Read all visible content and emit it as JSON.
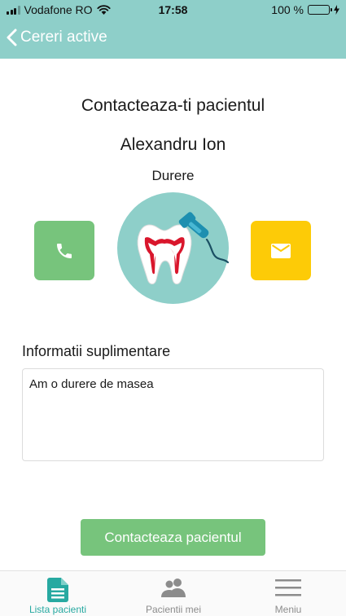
{
  "status_bar": {
    "carrier": "Vodafone RO",
    "time": "17:58",
    "battery": "100 %",
    "battery_level": 1.0
  },
  "nav": {
    "back_label": "Cereri active"
  },
  "main": {
    "title": "Contacteaza-ti pacientul",
    "patient_name": "Alexandru Ion",
    "category": "Durere",
    "info_label": "Informatii suplimentare",
    "info_text": "Am o durere de masea",
    "contact_button": "Contacteaza pacientul"
  },
  "tabs": [
    {
      "label": "Lista pacienti",
      "icon": "document-icon",
      "active": true
    },
    {
      "label": "Pacientii mei",
      "icon": "users-icon",
      "active": false
    },
    {
      "label": "Meniu",
      "icon": "hamburger-menu-icon",
      "active": false
    }
  ],
  "colors": {
    "header": "#8ecfc9",
    "call_button": "#77c47c",
    "mail_button": "#fdcb07",
    "contact_button": "#77c47c",
    "active_tab": "#27a9a1",
    "illustration_bg": "#8ecfc9"
  }
}
